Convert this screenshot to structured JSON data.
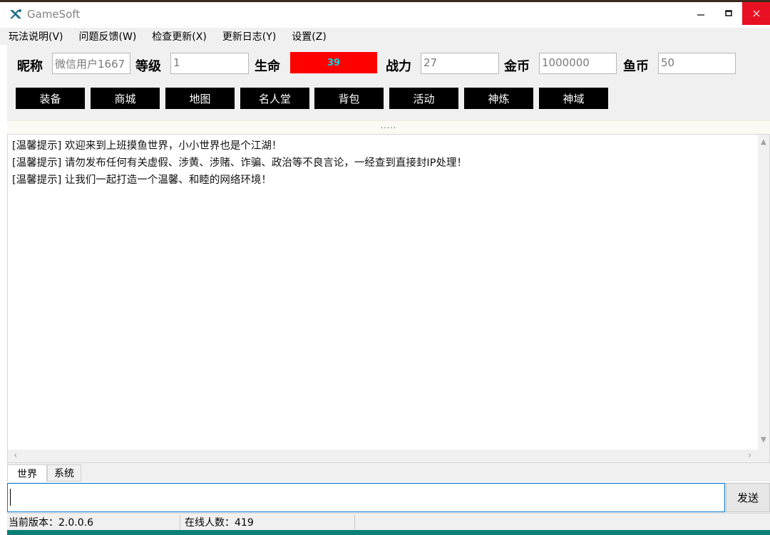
{
  "window": {
    "title": "GameSoft"
  },
  "menu": [
    {
      "label": "玩法说明(V)"
    },
    {
      "label": "问题反馈(W)"
    },
    {
      "label": "检查更新(X)"
    },
    {
      "label": "更新日志(Y)"
    },
    {
      "label": "设置(Z)"
    }
  ],
  "stats": {
    "nickname": {
      "label": "昵称",
      "value": "微信用户1667"
    },
    "level": {
      "label": "等级",
      "value": "1"
    },
    "hp": {
      "label": "生命",
      "value": "39"
    },
    "power": {
      "label": "战力",
      "value": "27"
    },
    "gold": {
      "label": "金币",
      "value": "1000000"
    },
    "fishcoin": {
      "label": "鱼币",
      "value": "50"
    }
  },
  "nav_buttons": [
    "装备",
    "商城",
    "地图",
    "名人堂",
    "背包",
    "活动",
    "神炼",
    "神域"
  ],
  "splitter": {
    "grip": "....."
  },
  "chat": {
    "lines": [
      "[温馨提示] 欢迎来到上班摸鱼世界，小小世界也是个江湖！",
      "[温馨提示] 请勿发布任何有关虚假、涉黄、涉赌、诈骗、政治等不良言论，一经查到直接封IP处理！",
      "[温馨提示] 让我们一起打造一个温馨、和睦的网络环境！"
    ]
  },
  "tabs": [
    {
      "label": "世界"
    },
    {
      "label": "系统"
    }
  ],
  "input": {
    "value": "",
    "send_label": "发送"
  },
  "status": {
    "version": "当前版本：2.0.0.6",
    "online": "在线人数：419"
  },
  "colors": {
    "hp_bg": "#ff0000",
    "hp_text": "#00d8e0",
    "close_btn": "#e81123",
    "accent": "#0078d7",
    "progress": "#0a7f74"
  }
}
